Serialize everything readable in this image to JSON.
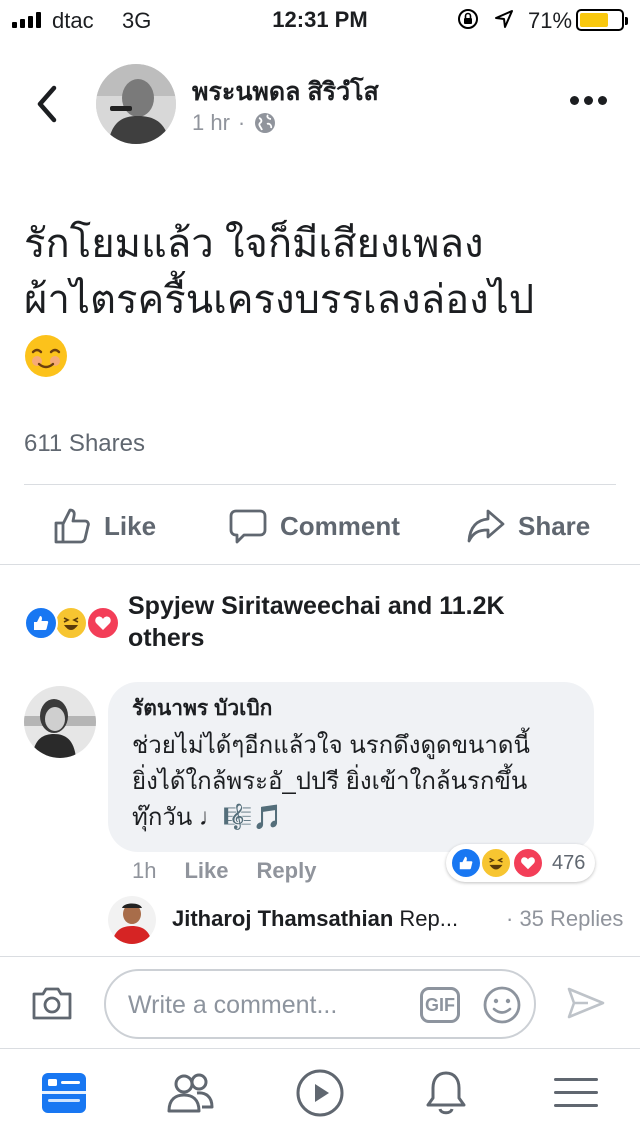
{
  "status_bar": {
    "carrier": "dtac",
    "network": "3G",
    "time": "12:31 PM",
    "battery": "71%",
    "battery_level": 0.71,
    "battery_color": "#f9c80e"
  },
  "post": {
    "author": "พระนพดล สิริวํโส",
    "time": "1 hr",
    "audience_icon": "globe-icon",
    "text_line1": "รักโยมแล้ว ใจก็มีเสียงเพลง",
    "text_line2": "ผ้าไตรครื้นเครงบรรเลงล่องไป",
    "emoji": "smiling-face-emoji",
    "shares": "611 Shares"
  },
  "actions": {
    "like": "Like",
    "comment": "Comment",
    "share": "Share"
  },
  "reactions": {
    "summary_line1": "Spyjew Siritaweechai and 11.2K",
    "summary_line2": "others",
    "types": [
      "like",
      "haha",
      "love"
    ],
    "colors": {
      "like": "#1877f2",
      "haha": "#f7c531",
      "love": "#f33e58"
    }
  },
  "comment": {
    "author": "รัตนาพร บัวเบิก",
    "line1": "ช่วยไม่ได้ๆอีกแล้วใจ นรกดึงดูดขนาดนี้",
    "line2": "ยิ่งได้ใกล้พระอั_ปปรี ยิ่งเข้าใกล้นรกขึ้น",
    "line3": "ทุ๊กวัน ♩🎼🎵",
    "time": "1h",
    "like": "Like",
    "reply": "Reply",
    "reaction_count": "476"
  },
  "reply_preview": {
    "author": "Jitharoj Thamsathian",
    "snippet": "Rep...",
    "count": "· 35 Replies"
  },
  "composer": {
    "placeholder": "Write a comment...",
    "gif": "GIF"
  },
  "tabs": [
    "news-feed-icon",
    "friends-icon",
    "watch-icon",
    "notifications-icon",
    "menu-icon"
  ],
  "accent": "#1877f2"
}
